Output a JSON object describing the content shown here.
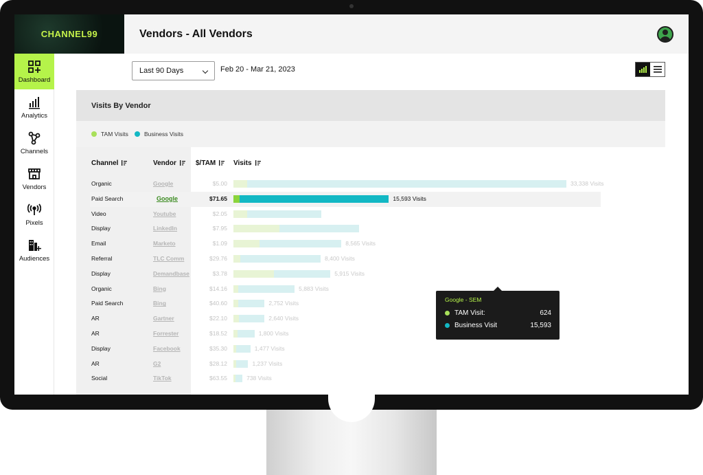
{
  "app": {
    "logo": "CHANNEL99",
    "page_title": "Vendors - All Vendors"
  },
  "sidebar": {
    "items": [
      {
        "label": "Dashboard",
        "icon": "dashboard-grid-icon",
        "active": true
      },
      {
        "label": "Analytics",
        "icon": "bar-chart-icon",
        "active": false
      },
      {
        "label": "Channels",
        "icon": "channels-network-icon",
        "active": false
      },
      {
        "label": "Vendors",
        "icon": "storefront-icon",
        "active": false
      },
      {
        "label": "Pixels",
        "icon": "broadcast-icon",
        "active": false
      },
      {
        "label": "Audiences",
        "icon": "audience-add-icon",
        "active": false
      }
    ]
  },
  "filters": {
    "range": "Last 90 Days",
    "date_range": "Feb 20 - Mar 21, 2023"
  },
  "card": {
    "title": "Visits By Vendor",
    "legend": [
      {
        "label": "TAM Visits",
        "color": "#a8e05a"
      },
      {
        "label": "Business Visits",
        "color": "#13b8c4"
      }
    ],
    "columns": [
      "Channel",
      "Vendor",
      "$/TAM",
      "Visits"
    ]
  },
  "chart_data": {
    "type": "bar",
    "title": "Visits By Vendor",
    "series": [
      {
        "name": "TAM Visits",
        "color": "#8bd43c",
        "values": [
          1400,
          624,
          1400,
          4800,
          2700,
          700,
          4200,
          500,
          500,
          600,
          400,
          300,
          300,
          200
        ]
      },
      {
        "name": "Business Visits",
        "color": "#13b8c4",
        "values": [
          33338,
          15593,
          7800,
          8300,
          8565,
          8400,
          5915,
          5883,
          2752,
          2640,
          1800,
          1477,
          1237,
          738
        ]
      }
    ],
    "rows": [
      {
        "channel": "Organic",
        "vendor": "Google",
        "cost": "$5.00",
        "visits_label": "33,338 Visits"
      },
      {
        "channel": "Paid Search",
        "vendor": "Google",
        "cost": "$71.65",
        "visits_label": "15,593 Visits",
        "active": true
      },
      {
        "channel": "Video",
        "vendor": "Youtube",
        "cost": "$2.05",
        "visits_label": ""
      },
      {
        "channel": "Display",
        "vendor": "LinkedIn",
        "cost": "$7.95",
        "visits_label": ""
      },
      {
        "channel": "Email",
        "vendor": "Marketo",
        "cost": "$1.09",
        "visits_label": "8,565 Visits"
      },
      {
        "channel": "Referral",
        "vendor": "TLC Comm",
        "cost": "$29.76",
        "visits_label": "8,400 Visits"
      },
      {
        "channel": "Display",
        "vendor": "Demandbase",
        "cost": "$3.78",
        "visits_label": "5,915 Visits"
      },
      {
        "channel": "Organic",
        "vendor": "Bing",
        "cost": "$14.16",
        "visits_label": "5,883 Visits"
      },
      {
        "channel": "Paid Search",
        "vendor": "Bing",
        "cost": "$40.60",
        "visits_label": "2,752 Visits"
      },
      {
        "channel": "AR",
        "vendor": "Gartner",
        "cost": "$22.10",
        "visits_label": "2,640 Visits"
      },
      {
        "channel": "AR",
        "vendor": "Forrester",
        "cost": "$18.52",
        "visits_label": "1,800 Visits"
      },
      {
        "channel": "Display",
        "vendor": "Facebook",
        "cost": "$35.30",
        "visits_label": "1,477 Visits"
      },
      {
        "channel": "AR",
        "vendor": "G2",
        "cost": "$28.12",
        "visits_label": "1,237 Visits"
      },
      {
        "channel": "Social",
        "vendor": "TikTok",
        "cost": "$63.55",
        "visits_label": "738 Visits"
      }
    ]
  },
  "tooltip": {
    "title": "Google - SEM",
    "rows": [
      {
        "label": "TAM Visit:",
        "value": "624",
        "color": "#a8e05a"
      },
      {
        "label": "Business Visit",
        "value": "15,593",
        "color": "#13b8c4"
      }
    ]
  }
}
